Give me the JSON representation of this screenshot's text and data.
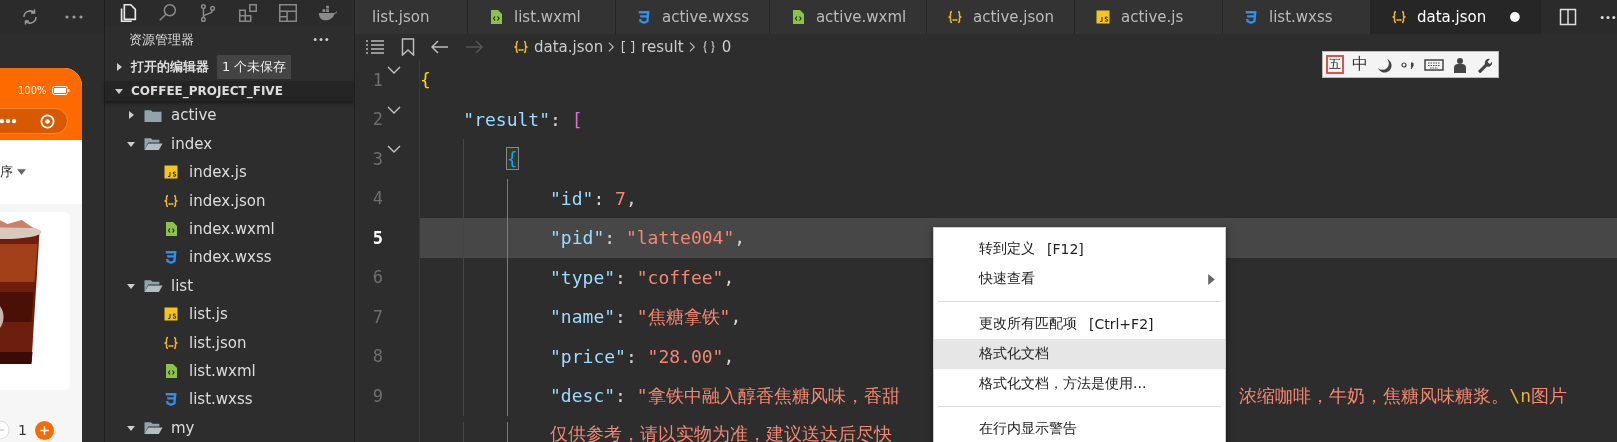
{
  "simulator": {
    "battery": "100%",
    "sort_label": "序",
    "quantity": "1"
  },
  "activity_bar": [
    {
      "kind": "files",
      "selected": true
    },
    {
      "kind": "search",
      "selected": false
    },
    {
      "kind": "branch",
      "selected": false
    },
    {
      "kind": "extensions",
      "selected": false
    },
    {
      "kind": "layout",
      "selected": false
    },
    {
      "kind": "docker",
      "selected": false
    }
  ],
  "tabs": [
    {
      "label": "list.json",
      "selected": false,
      "modified": false
    },
    {
      "label": "list.wxml",
      "kind": "wxml",
      "selected": false,
      "modified": false
    },
    {
      "label": "active.wxss",
      "kind": "wxss",
      "selected": false,
      "modified": false
    },
    {
      "label": "active.wxml",
      "kind": "wxml",
      "selected": false,
      "modified": false
    },
    {
      "label": "active.json",
      "kind": "json",
      "selected": false,
      "modified": false
    },
    {
      "label": "active.js",
      "kind": "js",
      "selected": false,
      "modified": false
    },
    {
      "label": "list.wxss",
      "kind": "wxss",
      "selected": false,
      "modified": false
    },
    {
      "label": "data.json",
      "kind": "json",
      "selected": true,
      "modified": true
    }
  ],
  "breadcrumb": [
    {
      "kind": "json",
      "label": "data.json"
    },
    {
      "kind": "array",
      "label": "result"
    },
    {
      "kind": "object",
      "label": "0"
    }
  ],
  "explorer": {
    "title": "资源管理器",
    "open_editors": {
      "label": "打开的编辑器",
      "badge": "1 个未保存",
      "expanded": false
    },
    "project": {
      "label": "COFFEE_PROJECT_FIVE",
      "expanded": true
    },
    "tree": [
      {
        "label": "active",
        "kind": "folder",
        "expanded": false
      },
      {
        "label": "index",
        "kind": "folder",
        "expanded": true,
        "children": [
          {
            "label": "index.js",
            "kind": "js"
          },
          {
            "label": "index.json",
            "kind": "json"
          },
          {
            "label": "index.wxml",
            "kind": "wxml"
          },
          {
            "label": "index.wxss",
            "kind": "wxss"
          }
        ]
      },
      {
        "label": "list",
        "kind": "folder",
        "expanded": true,
        "children": [
          {
            "label": "list.js",
            "kind": "js"
          },
          {
            "label": "list.json",
            "kind": "json"
          },
          {
            "label": "list.wxml",
            "kind": "wxml"
          },
          {
            "label": "list.wxss",
            "kind": "wxss"
          }
        ]
      },
      {
        "label": "my",
        "kind": "folder",
        "expanded": true
      }
    ]
  },
  "editor": {
    "lines": [
      {
        "number": "1",
        "foldable": true,
        "current": false,
        "tokens": [
          {
            "t": "{",
            "kind": "brace1"
          }
        ],
        "children": [
          {
            "number": "2",
            "foldable": true,
            "current": false,
            "tokens": [
              {
                "t": "\"result\"",
                "kind": "key"
              },
              {
                "t": ": ",
                "kind": "punct"
              },
              {
                "t": "[",
                "kind": "brace2"
              }
            ],
            "children": [
              {
                "number": "3",
                "foldable": true,
                "current": false,
                "tokens": [
                  {
                    "t": "{",
                    "kind": "brace3",
                    "matched": true
                  }
                ],
                "children": [
                  {
                    "number": "4",
                    "foldable": false,
                    "current": false,
                    "tokens": [
                      {
                        "t": "\"id\"",
                        "kind": "key"
                      },
                      {
                        "t": ": ",
                        "kind": "punct"
                      },
                      {
                        "t": "7",
                        "kind": "number"
                      },
                      {
                        "t": ",",
                        "kind": "punct"
                      }
                    ]
                  },
                  {
                    "number": "5",
                    "foldable": false,
                    "current": true,
                    "tokens": [
                      {
                        "t": "\"pid\"",
                        "kind": "key"
                      },
                      {
                        "t": ": ",
                        "kind": "punct"
                      },
                      {
                        "t": "\"latte004\"",
                        "kind": "string"
                      },
                      {
                        "t": ",",
                        "kind": "punct"
                      }
                    ]
                  },
                  {
                    "number": "6",
                    "foldable": false,
                    "current": false,
                    "tokens": [
                      {
                        "t": "\"type\"",
                        "kind": "key"
                      },
                      {
                        "t": ": ",
                        "kind": "punct"
                      },
                      {
                        "t": "\"coffee\"",
                        "kind": "string"
                      },
                      {
                        "t": ",",
                        "kind": "punct"
                      }
                    ]
                  },
                  {
                    "number": "7",
                    "foldable": false,
                    "current": false,
                    "tokens": [
                      {
                        "t": "\"name\"",
                        "kind": "key"
                      },
                      {
                        "t": ": ",
                        "kind": "punct"
                      },
                      {
                        "t": "\"焦糖拿铁\"",
                        "kind": "string"
                      },
                      {
                        "t": ",",
                        "kind": "punct"
                      }
                    ]
                  },
                  {
                    "number": "8",
                    "foldable": false,
                    "current": false,
                    "tokens": [
                      {
                        "t": "\"price\"",
                        "kind": "key"
                      },
                      {
                        "t": ": ",
                        "kind": "punct"
                      },
                      {
                        "t": "\"28.00\"",
                        "kind": "string"
                      },
                      {
                        "t": ",",
                        "kind": "punct"
                      }
                    ]
                  },
                  {
                    "number": "9",
                    "foldable": false,
                    "current": false,
                    "tokens": [
                      {
                        "t": "\"desc\"",
                        "kind": "key"
                      },
                      {
                        "t": ": ",
                        "kind": "punct"
                      },
                      {
                        "t": "\"拿铁中融入醇香焦糖风味，香甜",
                        "kind": "string"
                      }
                    ],
                    "tail": [
                      {
                        "t": "浓缩咖啡，牛奶，焦糖风味糖浆。",
                        "kind": "string"
                      },
                      {
                        "t": "\\n",
                        "kind": "escape"
                      },
                      {
                        "t": "图片",
                        "kind": "string"
                      }
                    ],
                    "wrap": [
                      {
                        "t": "仅供参考，请以实物为准，建议送达后尽快",
                        "kind": "string"
                      }
                    ]
                  }
                ]
              }
            ]
          }
        ]
      }
    ]
  },
  "context_menu": [
    {
      "kind": "item",
      "label": "转到定义",
      "shortcut": "[F12]",
      "submenu": false,
      "highlighted": false
    },
    {
      "kind": "item",
      "label": "快速查看",
      "submenu": true,
      "highlighted": false
    },
    {
      "kind": "separator"
    },
    {
      "kind": "item",
      "label": "更改所有匹配项",
      "shortcut": "[Ctrl+F2]",
      "submenu": false,
      "highlighted": false
    },
    {
      "kind": "item",
      "label": "格式化文档",
      "submenu": false,
      "highlighted": true
    },
    {
      "kind": "item",
      "label": "格式化文档，方法是使用...",
      "submenu": false,
      "highlighted": false
    },
    {
      "kind": "separator"
    },
    {
      "kind": "item",
      "label": "在行内显示警告",
      "submenu": false,
      "highlighted": false
    }
  ],
  "ime_toolbar": {
    "labels": [
      "五",
      "中"
    ]
  }
}
